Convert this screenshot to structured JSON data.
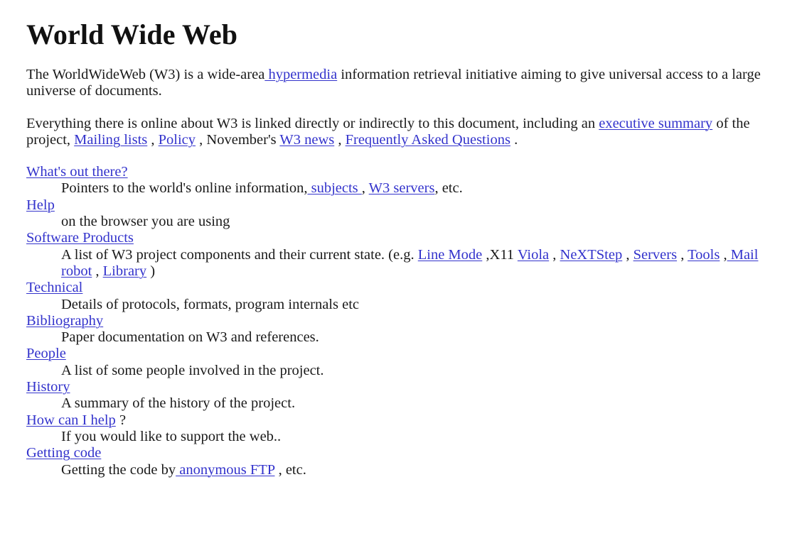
{
  "document": {
    "title": "World Wide Web",
    "link_color": "#3333cc",
    "text_color": "#1a1a1a",
    "background_color": "#ffffff"
  },
  "intro": {
    "p1_a": "The WorldWideWeb (W3) is a wide-area",
    "p1_link_hypermedia": " hypermedia",
    "p1_b": " information retrieval initiative aiming to give universal access to a large universe of documents.",
    "p2_a": "Everything there is online about W3 is linked directly or indirectly to this document, including an ",
    "p2_link_exec_summary": "executive summary",
    "p2_b": " of the project, ",
    "p2_link_mailing": "Mailing lists",
    "p2_sep1": " , ",
    "p2_link_policy": "Policy",
    "p2_sep2": " , November's ",
    "p2_link_w3news": "W3 news",
    "p2_sep3": " , ",
    "p2_link_faq": "Frequently Asked Questions",
    "p2_end": " ."
  },
  "index": {
    "entries": [
      {
        "term_link": "What's out there?",
        "def_a": "Pointers to the world's online information,",
        "def_link_subjects": " subjects ",
        "def_sep1": ", ",
        "def_link_w3servers": "W3 servers",
        "def_end": ", etc."
      },
      {
        "term_link": "Help",
        "def_a": "on the browser you are using"
      },
      {
        "term_link": "Software Products",
        "def_a": "A list of W3 project components and their current state. (e.g. ",
        "def_link_linemode": "Line Mode",
        "def_sep1": " ,X11 ",
        "def_link_viola": "Viola",
        "def_sep2": " , ",
        "def_link_nextstep": "NeXTStep",
        "def_sep3": " , ",
        "def_link_servers": "Servers",
        "def_sep4": " , ",
        "def_link_tools": "Tools",
        "def_sep5": " ,",
        "def_link_mailrobot": " Mail robot",
        "def_sep6": " , ",
        "def_link_library": "Library",
        "def_end": " )"
      },
      {
        "term_link": "Technical",
        "def_a": "Details of protocols, formats, program internals etc"
      },
      {
        "term_link": "Bibliography",
        "def_a": "Paper documentation on W3 and references."
      },
      {
        "term_link": "People",
        "def_a": "A list of some people involved in the project."
      },
      {
        "term_link": "History",
        "def_a": "A summary of the history of the project."
      },
      {
        "term_link": "How can I help",
        "term_suffix": " ?",
        "def_a": "If you would like to support the web.."
      },
      {
        "term_link": "Getting code",
        "def_a": "Getting the code by",
        "def_link_ftp": " anonymous FTP",
        "def_end": " , etc."
      }
    ]
  }
}
